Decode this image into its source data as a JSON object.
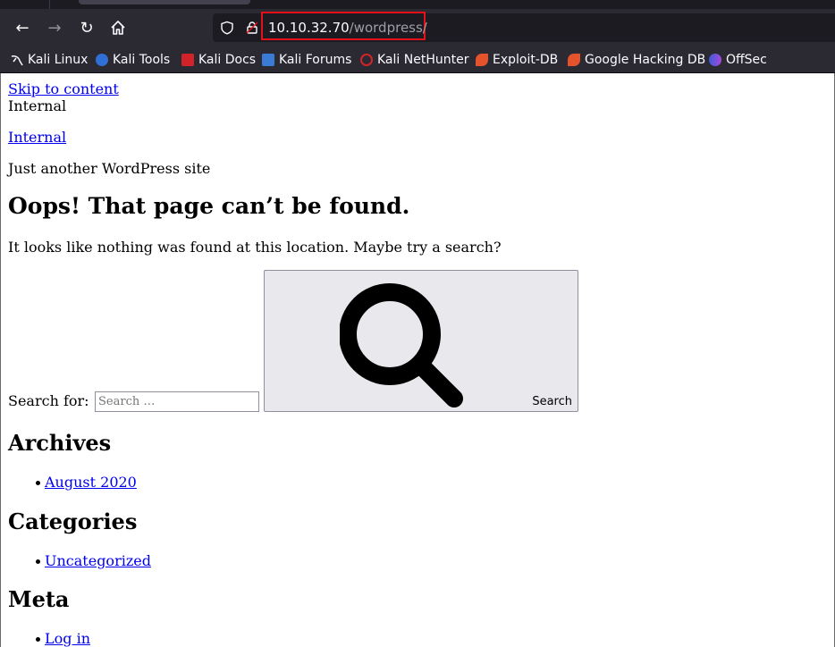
{
  "browser": {
    "url_host": "10.10.32.70",
    "url_path": "/wordpress/",
    "bookmarks": [
      {
        "label": "Kali Linux",
        "icon": "kali-dragon-icon"
      },
      {
        "label": "Kali Tools",
        "icon": "kali-tools-icon"
      },
      {
        "label": "Kali Docs",
        "icon": "kali-docs-icon"
      },
      {
        "label": "Kali Forums",
        "icon": "kali-forums-icon"
      },
      {
        "label": "Kali NetHunter",
        "icon": "nethunter-icon"
      },
      {
        "label": "Exploit-DB",
        "icon": "exploit-db-icon"
      },
      {
        "label": "Google Hacking DB",
        "icon": "ghdb-icon"
      },
      {
        "label": "OffSec",
        "icon": "offsec-icon"
      }
    ],
    "highlight_color": "#e5101a"
  },
  "page": {
    "skip_link": "Skip to content",
    "site_name_plain": "Internal",
    "site_name_link": "Internal",
    "tagline": "Just another WordPress site",
    "error_title": "Oops! That page can’t be found.",
    "error_message": "It looks like nothing was found at this location. Maybe try a search?",
    "search": {
      "label": "Search for:",
      "placeholder": "Search …",
      "button_label": "Search"
    },
    "archives": {
      "heading": "Archives",
      "items": [
        "August 2020"
      ]
    },
    "categories": {
      "heading": "Categories",
      "items": [
        "Uncategorized"
      ]
    },
    "meta": {
      "heading": "Meta",
      "items": [
        "Log in"
      ]
    }
  }
}
